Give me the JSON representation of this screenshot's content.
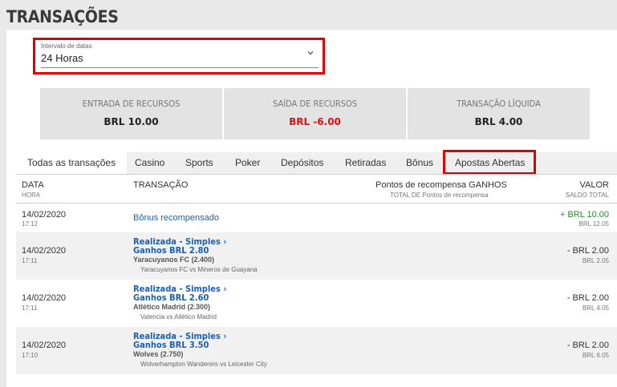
{
  "page_title": "TRANSAÇÕES",
  "date_range": {
    "label": "Intervalo de datas",
    "value": "24 Horas",
    "icon": "chevron-down-icon"
  },
  "summary": [
    {
      "label": "ENTRADA DE RECURSOS",
      "value": "BRL 10.00",
      "color": "#222222"
    },
    {
      "label": "SAÍDA DE RECURSOS",
      "value": "BRL -6.00",
      "color": "#e01010"
    },
    {
      "label": "TRANSAÇÃO LÍQUIDA",
      "value": "BRL 4.00",
      "color": "#222222"
    }
  ],
  "tabs": [
    "Todas as transações",
    "Casino",
    "Sports",
    "Poker",
    "Depósitos",
    "Retiradas",
    "Bônus",
    "Apostas Abertas"
  ],
  "table_header": {
    "date": "DATA",
    "time": "HORA",
    "transaction": "TRANSAÇÃO",
    "points": "Pontos de recompensa GANHOS",
    "points_total": "TOTAL DE Pontos de recompensa",
    "value": "VALOR",
    "balance": "SALDO TOTAL"
  },
  "rows": [
    {
      "date": "14/02/2020",
      "time": "17:12",
      "title": "Bônus recompensado",
      "amount": "+ BRL 10.00",
      "balance": "BRL 12.05"
    },
    {
      "date": "14/02/2020",
      "time": "17:11",
      "title": "Realizada - Simples",
      "win": "Ganhos BRL 2.80",
      "team": "Yaracuyanos FC (2.400)",
      "match": "Yaracuyanos FC vs Mineros de Guayana",
      "amount": "- BRL 2.00",
      "balance": "BRL 2.05"
    },
    {
      "date": "14/02/2020",
      "time": "17:11",
      "title": "Realizada - Simples",
      "win": "Ganhos BRL 2.60",
      "team": "Atlético Madrid (2.300)",
      "match": "Valencia vs Atlético Madrid",
      "amount": "- BRL 2.00",
      "balance": "BRL 4.05"
    },
    {
      "date": "14/02/2020",
      "time": "17:10",
      "title": "Realizada - Simples",
      "win": "Ganhos BRL 3.50",
      "team": "Wolves (2.750)",
      "match": "Wolverhampton Wanderers vs Leicester City",
      "amount": "- BRL 2.00",
      "balance": "BRL 6.05"
    }
  ],
  "colors": {
    "highlight": "#e00000",
    "link": "#1d5fb0",
    "positive": "#2a8a2a",
    "negative": "#e01010"
  }
}
